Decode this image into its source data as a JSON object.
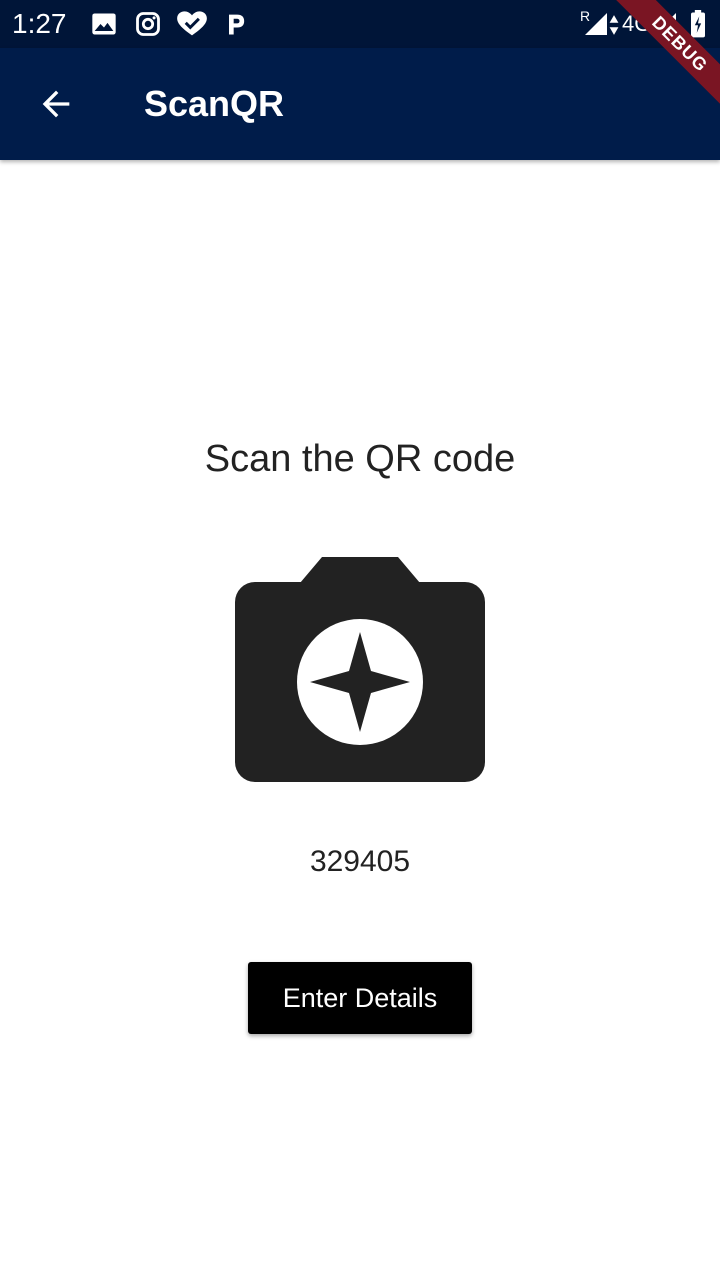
{
  "status_bar": {
    "time": "1:27",
    "network": "4G",
    "roaming": "R",
    "icons": [
      "image-icon",
      "instagram-icon",
      "heart-check-icon",
      "paytm-p-icon",
      "signal-icon",
      "battery-icon"
    ]
  },
  "app_bar": {
    "title": "ScanQR",
    "back_icon": "arrow-back-icon",
    "background": "#001c4a"
  },
  "debug_banner": {
    "label": "DEBUG",
    "color": "#7a1523"
  },
  "main": {
    "heading": "Scan the QR code",
    "camera_icon": "camera-enhance-icon",
    "code": "329405",
    "enter_button_label": "Enter Details"
  }
}
